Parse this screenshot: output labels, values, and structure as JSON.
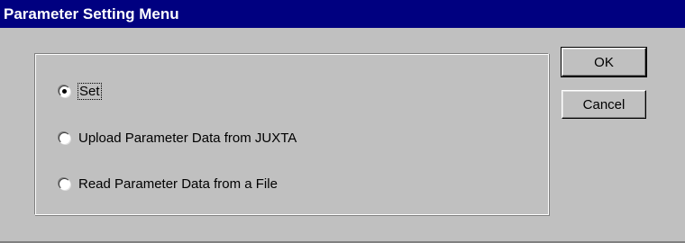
{
  "window": {
    "title": "Parameter Setting Menu"
  },
  "options": [
    {
      "label": "Set",
      "selected": true
    },
    {
      "label": "Upload Parameter Data from JUXTA",
      "selected": false
    },
    {
      "label": "Read Parameter Data from a File",
      "selected": false
    }
  ],
  "buttons": {
    "ok_label": "OK",
    "cancel_label": "Cancel"
  },
  "colors": {
    "titlebar": "#000080",
    "face": "#c0c0c0"
  }
}
